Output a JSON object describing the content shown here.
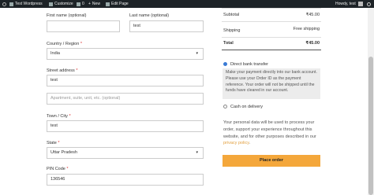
{
  "adminbar": {
    "site": "Test Wordpress",
    "customize": "Customize",
    "comments": "0",
    "new": "New",
    "edit": "Edit Page",
    "greeting": "Howdy, test"
  },
  "form": {
    "first_name": {
      "label": "First name (optional)",
      "value": ""
    },
    "last_name": {
      "label": "Last name (optional)",
      "value": "test"
    },
    "country": {
      "label": "Country / Region",
      "required": "*",
      "value": "India"
    },
    "street": {
      "label": "Street address",
      "required": "*",
      "value": "test",
      "placeholder2": "Apartment, suite, unit, etc. (optional)"
    },
    "city": {
      "label": "Town / City",
      "required": "*",
      "value": "test"
    },
    "state": {
      "label": "State",
      "required": "*",
      "value": "Uttar Pradesh"
    },
    "pin": {
      "label": "PIN Code",
      "required": "*",
      "value": "136546"
    }
  },
  "summary": {
    "subtotal_label": "Subtotal",
    "subtotal_value": "₹45.00",
    "shipping_label": "Shipping",
    "shipping_value": "Free shipping",
    "total_label": "Total",
    "total_value": "₹45.00"
  },
  "payment": {
    "bank_label": "Direct bank transfer",
    "bank_desc": "Make your payment directly into our bank account. Please use your Order ID as the payment reference. Your order will not be shipped until the funds have cleared in our account.",
    "cod_label": "Cash on delivery",
    "privacy_text": "Your personal data will be used to process your order, support your experience throughout this website, and for other purposes described in our",
    "privacy_link": "privacy policy",
    "place_order": "Place order"
  }
}
